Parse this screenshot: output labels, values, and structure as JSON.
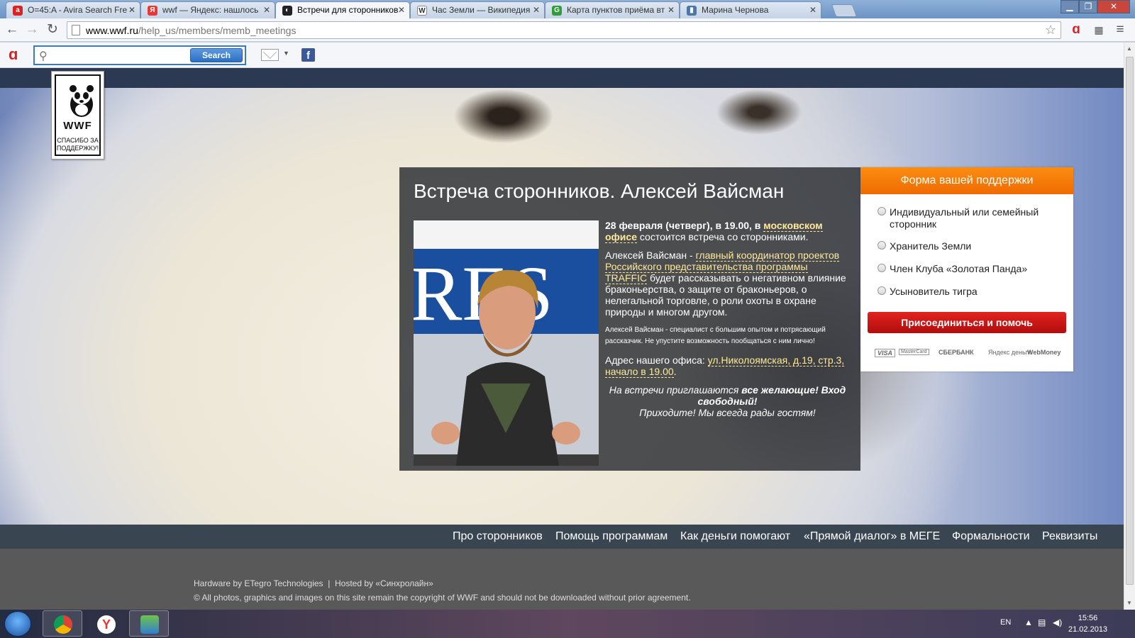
{
  "browser": {
    "tabs": [
      {
        "title": "O=45:A - Avira Search Fre",
        "favicon": "avira-icon",
        "color": "#d92222"
      },
      {
        "title": "wwf — Яндекс: нашлось",
        "favicon": "yandex-icon",
        "color": "#e53935"
      },
      {
        "title": "Встречи для сторонников",
        "favicon": "wwf-panda-icon",
        "color": "#222222",
        "active": true
      },
      {
        "title": "Час Земли — Википедия",
        "favicon": "wikipedia-icon",
        "color": "#444444"
      },
      {
        "title": "Карта пунктов приёма вт",
        "favicon": "greenpeace-g-icon",
        "color": "#2e9d3a"
      },
      {
        "title": "Марина Чернова",
        "favicon": "vk-icon",
        "color": "#4a76a8"
      }
    ],
    "url_host": "www.wwf.ru",
    "url_path": "/help_us/members/memb_meetings",
    "search_button": "Search",
    "search_placeholder": ""
  },
  "page": {
    "logo": {
      "text": "WWF",
      "thanks": "СПАСИБО ЗА ПОДДЕРЖКУ!"
    },
    "article": {
      "title": "Встреча сторонников. Алексей Вайсман",
      "p1_date": "28 февраля (четверг), в 19.00, в ",
      "p1_link": "московском офисе",
      "p1_rest": " состоится встреча со сторонниками.",
      "p2_name": "Алексей Вайсман - ",
      "p2_link": "главный координатор проектов Российского представительства программы TRAFFIC",
      "p2_rest": " будет рассказывать о негативном влияние браконьерства, о защите от браконьеров, о нелегальной торговле, о роли охоты в охране природы и многом другом.",
      "p3": "Алексей Вайсман - специалист с большим опытом и потрясающий рассказчик. Не упустите возможность пообщаться с ним лично!",
      "p4_label": "Адрес нашего офиса: ",
      "p4_link": "ул.Николоямская, д.19, стр.3, начало в 19.00",
      "p4_end": ".",
      "p5_a": "На встречи приглашаются ",
      "p5_b": "все желающие! Вход свободный!",
      "p5_c": "Приходите! Мы всегда рады гостям!"
    },
    "support": {
      "header": "Форма вашей поддержки",
      "options": [
        "Индивидуальный или семейный сторонник",
        "Хранитель Земли",
        "Член Клуба «Золотая Панда»",
        "Усыновитель тигра"
      ],
      "join_button": "Присоединиться и помочь",
      "payments": [
        "VISA",
        "MasterCard",
        "СБЕРБАНК",
        "Яндекс деньги",
        "WebMoney"
      ]
    },
    "footer_nav": [
      "Про сторонников",
      "Помощь программам",
      "Как деньги помогают",
      "«Прямой диалог» в МЕГЕ",
      "Формальности",
      "Реквизиты"
    ],
    "credit": "Hardware by ETegro Technologies  |  Hosted by «Синхролайн»",
    "copyright": "© All photos, graphics and images on this site remain the copyright of WWF and should not be downloaded without prior agreement."
  },
  "taskbar": {
    "lang": "EN",
    "time": "15:56",
    "date": "21.02.2013"
  },
  "colors": {
    "accent_orange": "#f07a00",
    "join_red": "#c41414",
    "link_yellow": "#ffe99a"
  }
}
